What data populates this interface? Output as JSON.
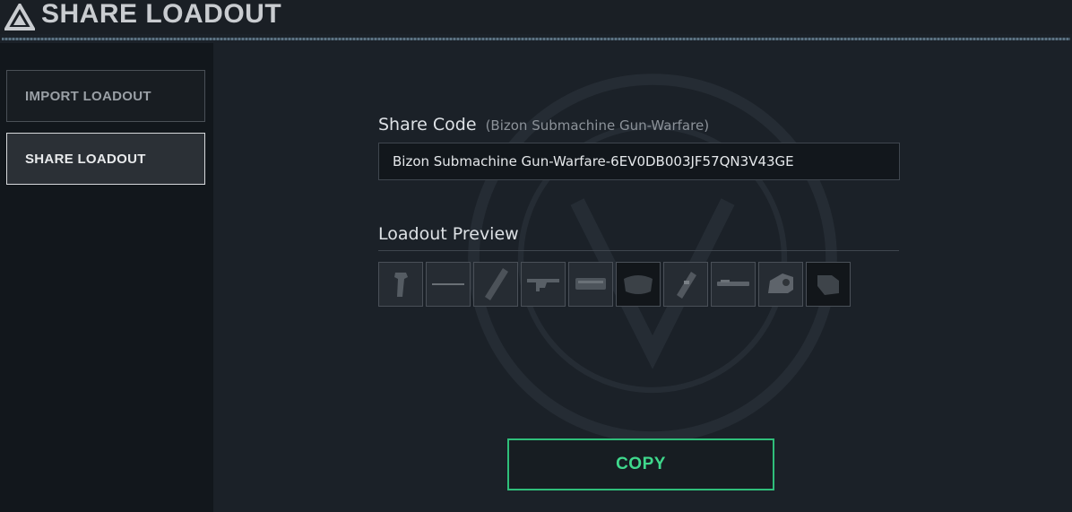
{
  "header": {
    "title": "SHARE LOADOUT",
    "logo_icon": "triangle-logo-icon"
  },
  "sidebar": {
    "items": [
      {
        "label": "IMPORT LOADOUT",
        "active": false
      },
      {
        "label": "SHARE LOADOUT",
        "active": true
      }
    ]
  },
  "share": {
    "label": "Share Code",
    "weapon_note": "(Bizon Submachine Gun-Warfare)",
    "code_value": "Bizon Submachine Gun-Warfare-6EV0DB003JF57QN3V43GE"
  },
  "preview": {
    "label": "Loadout Preview",
    "slots": [
      {
        "icon": "grip-icon"
      },
      {
        "icon": "rail-icon"
      },
      {
        "icon": "suppressor-icon"
      },
      {
        "icon": "rifle-icon"
      },
      {
        "icon": "receiver-icon"
      },
      {
        "icon": "stock-pad-icon"
      },
      {
        "icon": "magazine-icon"
      },
      {
        "icon": "barrel-icon"
      },
      {
        "icon": "sight-icon"
      },
      {
        "icon": "buttstock-icon"
      }
    ]
  },
  "actions": {
    "copy_label": "COPY"
  },
  "colors": {
    "accent": "#3fd88c",
    "background": "#1b2128",
    "sidebar": "#12171c"
  }
}
